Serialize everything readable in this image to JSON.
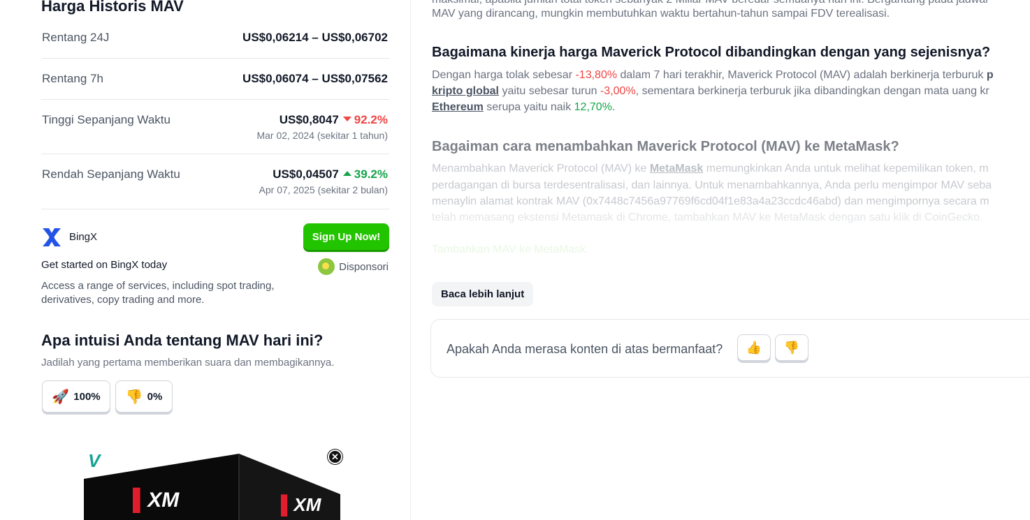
{
  "history": {
    "title": "Harga Historis MAV",
    "rows": [
      {
        "label": "Rentang 24J",
        "value": "US$0,06214 – US$0,06702"
      },
      {
        "label": "Rentang 7h",
        "value": "US$0,06074 – US$0,07562"
      },
      {
        "label": "Tinggi Sepanjang Waktu",
        "value": "US$0,8047",
        "change": "92.2%",
        "direction": "down",
        "date": "Mar 02, 2024 (sekitar 1 tahun)"
      },
      {
        "label": "Rendah Sepanjang Waktu",
        "value": "US$0,04507",
        "change": "39.2%",
        "direction": "up",
        "date": "Apr 07, 2025 (sekitar 2 bulan)"
      }
    ]
  },
  "sponsor": {
    "name": "BingX",
    "cta": "Sign Up Now!",
    "tagline": "Get started on BingX today",
    "sponsored_label": "Disponsori",
    "description": "Access a range of services, including spot trading, derivatives, copy trading and more.",
    "logo_color": "#2354e6",
    "cta_color": "#22c400"
  },
  "sentiment": {
    "title": "Apa intuisi Anda tentang MAV hari ini?",
    "subtitle": "Jadilah yang pertama memberikan suara dan membagikannya.",
    "bullish_icon": "rocket-icon",
    "bullish_pct": "100%",
    "bearish_icon": "thumbs-down-icon",
    "bearish_pct": "0%"
  },
  "ad": {
    "close_icon": "close-icon",
    "brand": "XM"
  },
  "article": {
    "intro_line1": "maksimal, apabila jumlah total token sebanyak 2 Miliar MAV beredar semuanya hari ini. Bergantung pada jadwal",
    "intro_line2": "MAV yang dirancang, mungkin membutuhkan waktu bertahun-tahun sampai FDV terealisasi.",
    "q1": "Bagaimana kinerja harga Maverick Protocol dibandingkan dengan yang sejenisnya?",
    "q1_p1_a": "Dengan harga tolak sebesar ",
    "q1_p1_neg": "-13,80%",
    "q1_p1_b": " dalam 7 hari terakhir, Maverick Protocol (MAV) adalah berkinerja terburuk ",
    "q1_p1_c": "p",
    "q1_p2_link": "kripto global",
    "q1_p2_a": " yaitu sebesar turun ",
    "q1_p2_neg": "-3,00%",
    "q1_p2_b": ", sementara berkinerja terburuk jika dibandingkan dengan mata uang kr",
    "q1_p3_link": "Ethereum",
    "q1_p3_a": " serupa yaitu naik ",
    "q1_p3_pos": "12,70%",
    "q1_p3_b": ".",
    "q2": "Bagaiman cara menambahkan Maverick Protocol (MAV) ke MetaMask?",
    "q2_l1_a": "Menambahkan Maverick Protocol (MAV) ke ",
    "q2_l1_link": "MetaMask",
    "q2_l1_b": " memungkinkan Anda untuk melihat kepemilikan token, m",
    "q2_l2": "perdagangan di bursa terdesentralisasi, dan lainnya. Untuk menambahkannya, Anda perlu mengimpor MAV seba",
    "q2_l3": "menaylin alamat kontrak MAV (0x7448c7456a97769f6cd04f1e83a4a23ccdc46abd) dan mengimpornya secara m",
    "q2_l4": "telah memasang ekstensi Metamask di Chrome, tambahkan MAV ke MetaMask dengan satu klik di CoinGecko.",
    "q2_cta": "Tambahkan MAV ke MetaMask.",
    "read_more": "Baca lebih lanjut"
  },
  "feedback": {
    "question": "Apakah Anda merasa konten di atas bermanfaat?",
    "up_icon": "thumbs-up-icon",
    "down_icon": "thumbs-down-icon"
  }
}
